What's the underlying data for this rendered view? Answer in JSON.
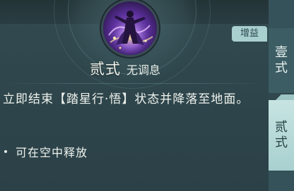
{
  "skill": {
    "name": "贰式",
    "subtitle": "无调息",
    "tag": "增益",
    "description": "立即结束【踏星行·悟】状态并降落至地面。",
    "bullets": [
      "可在空中释放"
    ]
  },
  "tabs": [
    {
      "label_line1": "壹",
      "label_line2": "式",
      "active": false
    },
    {
      "label_line1": "贰",
      "label_line2": "式",
      "active": true
    }
  ],
  "colors": {
    "background": "#2e464c",
    "tag_bg": "#a9cfcf",
    "active_tab": "#b9dad8",
    "text": "#f0f3ee"
  },
  "icons": {
    "skill_icon": "purple-dancer-skill-icon"
  }
}
